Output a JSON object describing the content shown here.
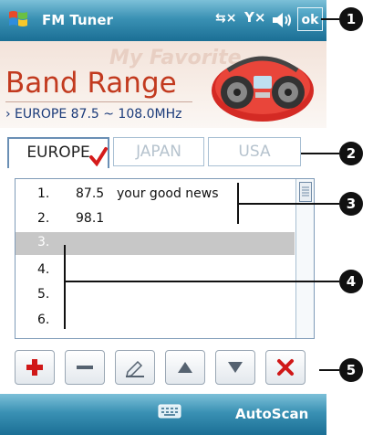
{
  "titlebar": {
    "app_title": "FM Tuner",
    "ok_label": "ok"
  },
  "banner": {
    "watermark": "My Favorite",
    "title": "Band Range",
    "range": "› EUROPE 87.5 ~ 108.0MHz"
  },
  "tabs": [
    {
      "label": "EUROPE",
      "selected": true
    },
    {
      "label": "JAPAN",
      "selected": false
    },
    {
      "label": "USA",
      "selected": false
    }
  ],
  "presets": [
    {
      "num": "1.",
      "freq": "87.5",
      "name": "your good news"
    },
    {
      "num": "2.",
      "freq": "98.1",
      "name": ""
    },
    {
      "num": "3.",
      "freq": "",
      "name": "",
      "selected": true
    },
    {
      "num": "4.",
      "freq": "",
      "name": ""
    },
    {
      "num": "5.",
      "freq": "",
      "name": ""
    },
    {
      "num": "6.",
      "freq": "",
      "name": ""
    }
  ],
  "toolbar": {
    "buttons": [
      "add-icon",
      "remove-icon",
      "edit-icon",
      "move-up-icon",
      "move-down-icon",
      "delete-icon"
    ]
  },
  "bottombar": {
    "right_label": "AutoScan",
    "keyboard_icon": "keyboard-icon"
  },
  "callouts": [
    "1",
    "2",
    "3",
    "4",
    "5"
  ],
  "colors": {
    "title_bar": "#3a91b4",
    "band_title": "#c23a1f",
    "selected_row": "#c7c7c7",
    "add_red": "#d01818"
  }
}
